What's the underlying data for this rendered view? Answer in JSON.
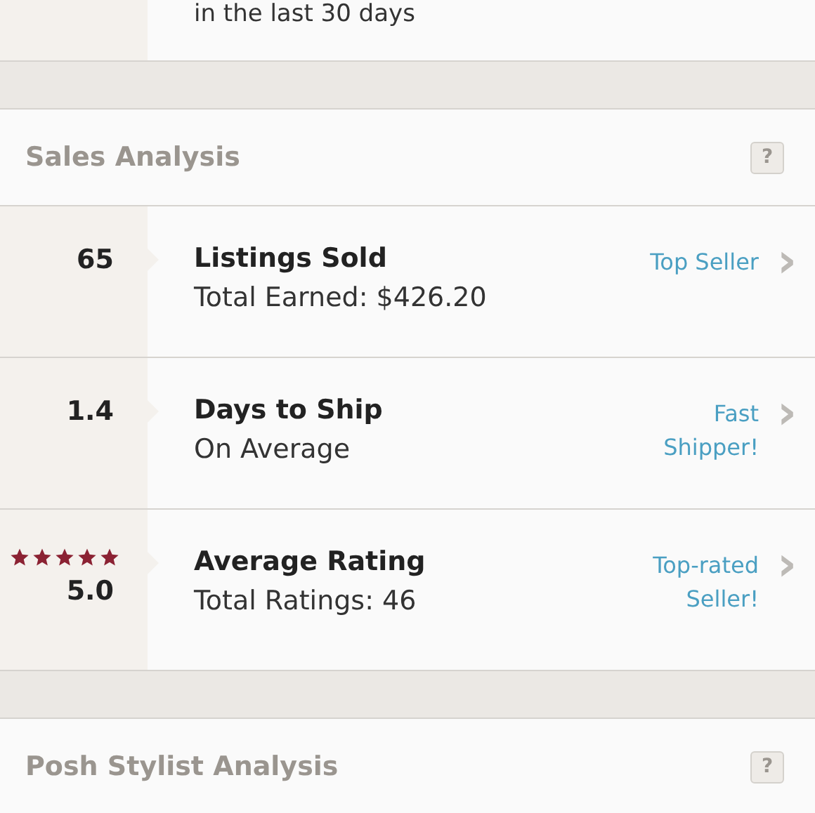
{
  "top_section": {
    "caption": "in the last 30 days"
  },
  "sales_analysis": {
    "title": "Sales Analysis",
    "help": "?",
    "rows": [
      {
        "kind": "number",
        "value": "65",
        "title": "Listings Sold",
        "subtitle": "Total Earned: $426.20",
        "badge": "Top Seller",
        "arrow": "›"
      },
      {
        "kind": "number",
        "value": "1.4",
        "title": "Days to Ship",
        "subtitle": "On Average",
        "badge": "Fast Shipper!",
        "arrow": "›"
      },
      {
        "kind": "rating",
        "value": "5.0",
        "stars": 5,
        "title": "Average Rating",
        "subtitle": "Total Ratings: 46",
        "badge": "Top-rated Seller!",
        "arrow": "›"
      }
    ]
  },
  "posh_stylist_analysis": {
    "title": "Posh Stylist Analysis",
    "help": "?"
  }
}
